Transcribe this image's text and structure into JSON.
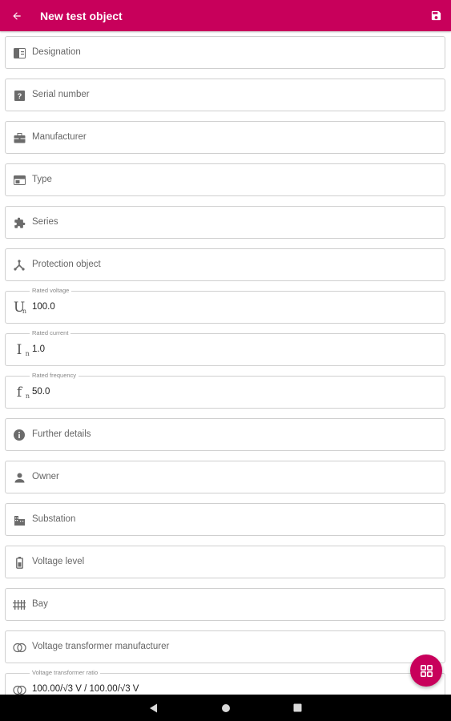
{
  "header": {
    "title": "New test object",
    "accent": "#c8005b"
  },
  "fields": {
    "designation": {
      "label": "Designation",
      "icon": "id-card-icon"
    },
    "serial_number": {
      "label": "Serial number",
      "icon": "question-box-icon"
    },
    "manufacturer": {
      "label": "Manufacturer",
      "icon": "briefcase-icon"
    },
    "type": {
      "label": "Type",
      "icon": "card-icon"
    },
    "series": {
      "label": "Series",
      "icon": "puzzle-icon"
    },
    "protection_object": {
      "label": "Protection object",
      "icon": "hub-icon"
    },
    "rated_voltage": {
      "float_label": "Rated voltage",
      "value": "100.0",
      "symbol": "U",
      "sub": "n"
    },
    "rated_current": {
      "float_label": "Rated current",
      "value": "1.0",
      "symbol": "I",
      "sub": "n"
    },
    "rated_frequency": {
      "float_label": "Rated frequency",
      "value": "50.0",
      "symbol": "f",
      "sub": "n"
    },
    "further_details": {
      "label": "Further details",
      "icon": "info-icon"
    },
    "owner": {
      "label": "Owner",
      "icon": "person-icon"
    },
    "substation": {
      "label": "Substation",
      "icon": "building-icon"
    },
    "voltage_level": {
      "label": "Voltage level",
      "icon": "battery-icon"
    },
    "bay": {
      "label": "Bay",
      "icon": "bay-icon"
    },
    "vt_manufacturer": {
      "label": "Voltage transformer manufacturer",
      "icon": "transformer-icon"
    },
    "vt_ratio": {
      "float_label": "Voltage transformer ratio",
      "value": "100.00/√3 V / 100.00/√3 V",
      "icon": "transformer-icon"
    }
  }
}
